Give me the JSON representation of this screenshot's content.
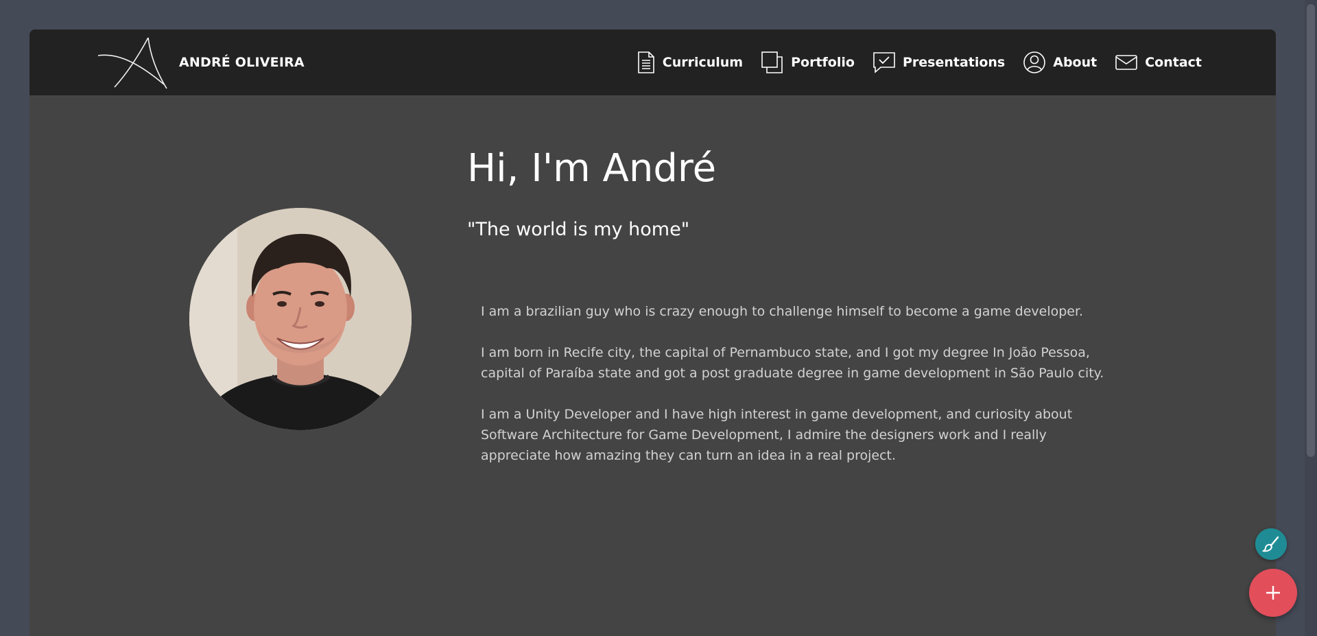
{
  "brand": {
    "name": "ANDRÉ OLIVEIRA",
    "logo_icon": "signature-a-logo"
  },
  "nav": {
    "items": [
      {
        "label": "Curriculum",
        "icon": "document-icon"
      },
      {
        "label": "Portfolio",
        "icon": "stacked-squares-icon"
      },
      {
        "label": "Presentations",
        "icon": "chat-check-icon"
      },
      {
        "label": "About",
        "icon": "user-circle-icon"
      },
      {
        "label": "Contact",
        "icon": "envelope-icon"
      }
    ]
  },
  "hero": {
    "title": "Hi, I'm André",
    "quote": "\"The world is my home\""
  },
  "bio": {
    "paragraphs": [
      "I am a brazilian guy who is crazy enough to challenge himself to become a game developer.",
      "I am born in Recife city, the capital of Pernambuco state, and I got my degree In João Pessoa, capital of Paraíba state and got a post graduate degree in game development in São Paulo city.",
      "I am a Unity Developer and I have high interest in game development, and curiosity about Software Architecture for Game Development, I admire the designers work and I really appreciate how amazing they can turn an idea in a real project."
    ]
  },
  "fabs": {
    "brush_icon": "paintbrush-icon",
    "add_icon": "plus-icon"
  },
  "colors": {
    "page_bg": "#454a57",
    "content_bg": "#444444",
    "navbar_bg": "#222222",
    "fab_brush": "#1f8c95",
    "fab_add": "#e34e5b"
  }
}
